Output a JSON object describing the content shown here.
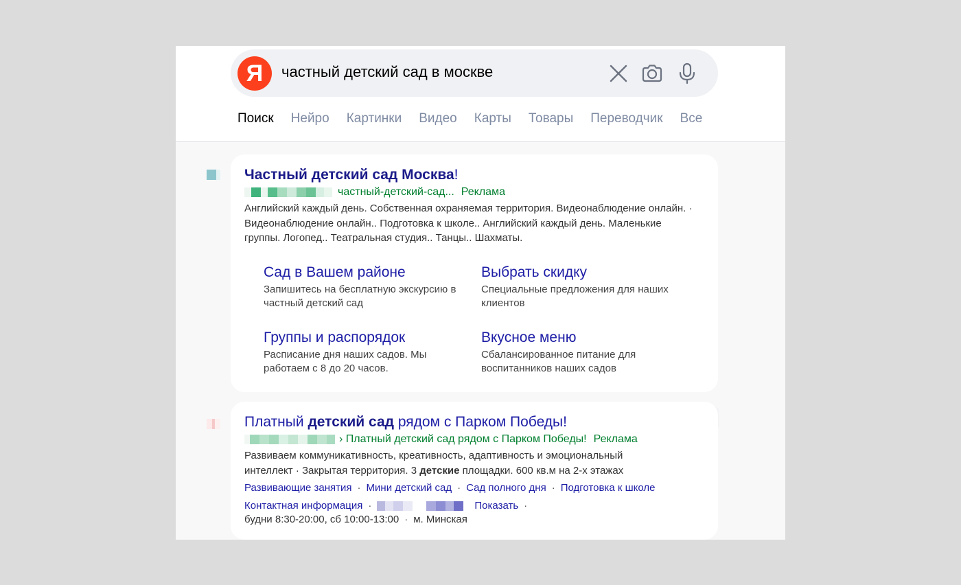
{
  "search": {
    "logo": "Я",
    "query": "частный детский сад в москве",
    "icons": [
      "clear-icon",
      "camera-icon",
      "microphone-icon"
    ]
  },
  "tabs": [
    "Поиск",
    "Нейро",
    "Картинки",
    "Видео",
    "Карты",
    "Товары",
    "Переводчик",
    "Все"
  ],
  "ad1": {
    "title_bold": "Частный детский сад Москва",
    "title_tail": "!",
    "url_path": "частный-детский-сад...",
    "ad_label": "Реклама",
    "description": "Английский каждый день. Собственная охраняемая территория. Видеонаблюдение онлайн. · Видеонаблюдение онлайн.. Подготовка к школе.. Английский каждый день. Маленькие группы. Логопед.. Театральная студия.. Танцы.. Шахматы.",
    "sitelinks": [
      {
        "title": "Сад в Вашем районе",
        "desc": "Запишитесь на бесплатную экскурсию в частный детский сад"
      },
      {
        "title": "Выбрать скидку",
        "desc": "Специальные предложения для наших клиентов"
      },
      {
        "title": "Группы и распорядок",
        "desc": "Расписание дня наших садов. Мы работаем с 8 до 20 часов."
      },
      {
        "title": "Вкусное меню",
        "desc": "Сбалансированное питание для воспитанников наших садов"
      }
    ]
  },
  "ad2": {
    "title_pre": "Платный ",
    "title_bold": "детский сад",
    "title_post": " рядом с Парком Победы!",
    "url_path": "› Платный детский сад рядом с Парком Победы!",
    "ad_label": "Реклама",
    "desc_line1": "Развиваем коммуникативность, креативность, адаптивность и эмоциональный",
    "desc_line2_pre": "интеллект · Закрытая территория. 3 ",
    "desc_line2_bold": "детские",
    "desc_line2_post": " площадки. 600 кв.м на 2-х этажах",
    "quick_links": [
      "Развивающие занятия",
      "Мини детский сад",
      "Сад полного дня",
      "Подготовка к школе"
    ],
    "contact_label": "Контактная информация",
    "show_label": "Показать",
    "hours": "будни 8:30-20:00, сб 10:00-13:00",
    "metro": "м. Минская"
  },
  "colors": {
    "brand": "#fc3f1d",
    "link": "#1d1da6",
    "url_green": "#007f2e",
    "tab_inactive": "#7f8ba3"
  }
}
